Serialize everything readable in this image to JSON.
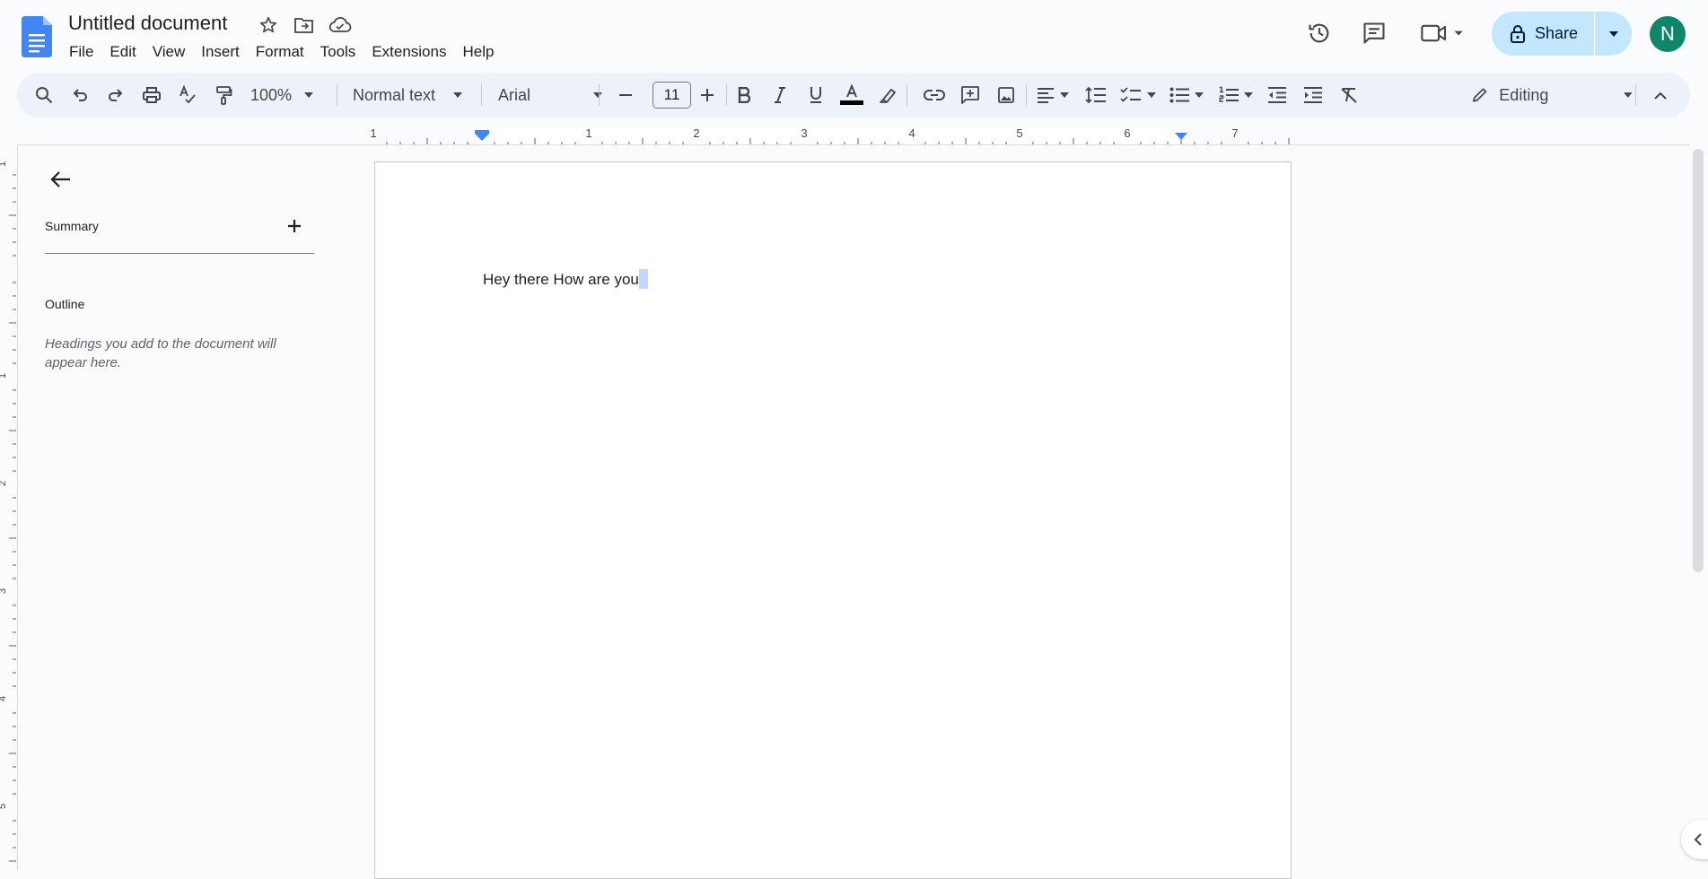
{
  "app": {
    "title": "Untitled document",
    "avatar_letter": "N"
  },
  "menu": [
    "File",
    "Edit",
    "View",
    "Insert",
    "Format",
    "Tools",
    "Extensions",
    "Help"
  ],
  "share": {
    "label": "Share"
  },
  "toolbar": {
    "zoom": "100%",
    "style": "Normal text",
    "font": "Arial",
    "font_size": "11",
    "editing_mode": "Editing"
  },
  "ruler": {
    "top_numbers": [
      "1",
      "1",
      "2",
      "3",
      "4",
      "5",
      "6",
      "7"
    ],
    "left_numbers": [
      "1",
      "1",
      "2",
      "3",
      "4",
      "5"
    ]
  },
  "outline": {
    "summary_label": "Summary",
    "outline_label": "Outline",
    "hint": "Headings you add to the document will appear here."
  },
  "document": {
    "text": "Hey there How are you"
  },
  "colors": {
    "accent": "#1a73e8",
    "share_bg": "#c2e7ff",
    "avatar_bg": "#0f8569"
  }
}
